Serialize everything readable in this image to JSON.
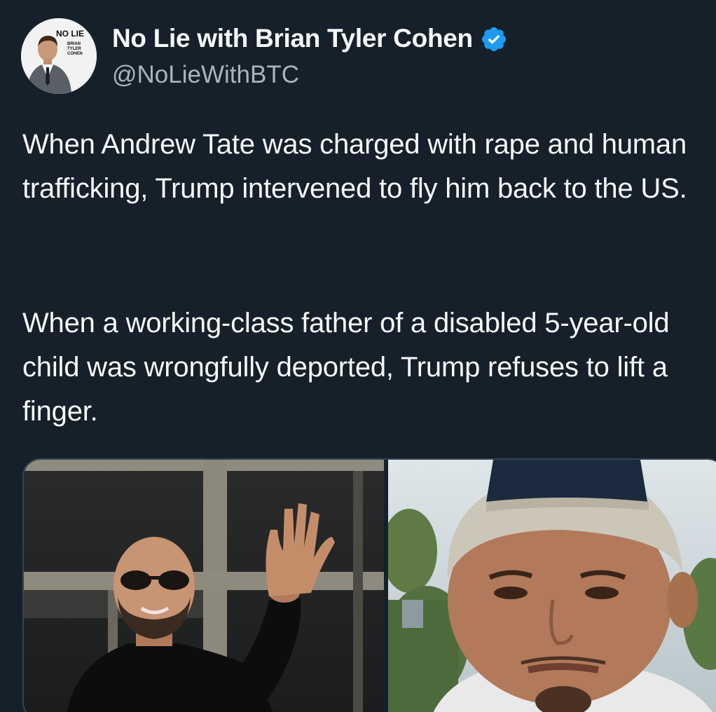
{
  "author": {
    "name": "No Lie with Brian Tyler Cohen",
    "handle": "@NoLieWithBTC",
    "verified": true,
    "avatar_text_top": "NO LIE",
    "avatar_text_small": "BRIAN TYLER COHEN"
  },
  "tweet": {
    "paragraphs": [
      "When Andrew Tate was charged with rape and human trafficking, Trump intervened to fly him back to the US.",
      "When a working-class father of a disabled 5-year-old child was wrongfully deported, Trump refuses to lift a finger."
    ]
  },
  "media": {
    "left_image": "photo-man-waving",
    "right_image": "photo-man-backwards-cap"
  },
  "colors": {
    "background": "#15202b",
    "text": "#f7f9f9",
    "secondary_text": "#a9b4bd",
    "verified": "#1d9bf0"
  }
}
